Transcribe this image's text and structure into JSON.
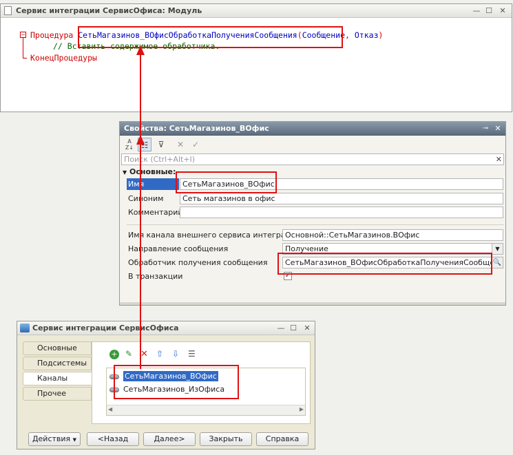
{
  "module_window": {
    "title": "Сервис интеграции СервисОфиса: Модуль",
    "code": {
      "proc_keyword": "Процедура",
      "proc_name": "СетьМагазинов_ВОфисОбработкаПолученияСообщения",
      "open_paren": "(",
      "param1": "Сообщение",
      "comma": ",",
      "param2": "Отказ",
      "close_paren": ")",
      "comment": "// Вставить содержимое обработчика.",
      "end_keyword": "КонецПроцедуры"
    }
  },
  "properties_window": {
    "title": "Свойства: СетьМагазинов_ВОфис",
    "search_placeholder": "Поиск (Ctrl+Alt+I)",
    "section_title": "Основные:",
    "name_label": "Имя",
    "name_value": "СетьМагазинов_ВОфис",
    "synonym_label": "Синоним",
    "synonym_value": "Сеть магазинов в офис",
    "comment_label": "Комментарий",
    "comment_value": "",
    "channel_label": "Имя канала внешнего сервиса интеграции",
    "channel_value": "Основной::СетьМагазинов.ВОфис",
    "direction_label": "Направление сообщения",
    "direction_value": "Получение",
    "handler_label": "Обработчик получения сообщения",
    "handler_value": "СетьМагазинов_ВОфисОбработкаПолученияСообщения",
    "transaction_label": "В транзакции",
    "transaction_checked": true
  },
  "service_window": {
    "title": "Сервис интеграции СервисОфиса",
    "tabs": [
      "Основные",
      "Подсистемы",
      "Каналы",
      "Прочее"
    ],
    "active_tab": "Каналы",
    "channels": [
      "СетьМагазинов_ВОфис",
      "СетьМагазинов_ИзОфиса"
    ],
    "buttons": {
      "actions": "Действия",
      "back": "<Назад",
      "next": "Далее>",
      "close": "Закрыть",
      "help": "Справка"
    }
  },
  "colors": {
    "highlight": "#e01010",
    "selection": "#316ac5",
    "keyword": "#d00000",
    "identifier": "#0000c0",
    "comment": "#006400"
  }
}
